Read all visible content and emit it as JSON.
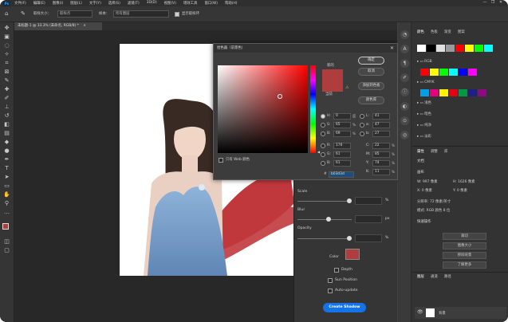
{
  "menubar": {
    "items": [
      "文件(F)",
      "编辑(E)",
      "图像(I)",
      "图层(L)",
      "文字(Y)",
      "选择(S)",
      "滤镜(T)",
      "3D(D)",
      "视图(V)",
      "增效工具",
      "窗口(W)",
      "帮助(H)"
    ],
    "minimize": "—",
    "restore": "❐",
    "close": "✕"
  },
  "optbar": {
    "sample_size_label": "取样大小：",
    "sample_size_value": "取样点",
    "sample_label": "样本：",
    "sample_value": "所有图层",
    "show_ring_label": "显示取样环"
  },
  "document": {
    "tab_title": "未标题-1 @ 33.3% (未命名, RGB/8) *",
    "tab_close": "×"
  },
  "picker": {
    "title": "拾色器（前景色）",
    "new_label": "新的",
    "current_label": "当前",
    "ok": "确定",
    "cancel": "取消",
    "add_swatch": "添加到色板",
    "color_libraries": "颜色库",
    "web_only": "只有 Web 颜色",
    "h_label": "H:",
    "h_value": "0",
    "h_unit": "度",
    "s_label": "S:",
    "s_value": "65",
    "s_unit": "%",
    "b_label": "B:",
    "b_value": "69",
    "b_unit": "%",
    "r_label": "R:",
    "r_value": "176",
    "g_label": "G:",
    "g_value": "61",
    "bl_label": "B:",
    "bl_value": "61",
    "l_label": "L:",
    "l_value": "41",
    "a_label": "a:",
    "a_value": "47",
    "lb_label": "b:",
    "lb_value": "27",
    "c_label": "C:",
    "c_value": "22",
    "c_unit": "%",
    "m_label": "M:",
    "m_value": "85",
    "m_unit": "%",
    "y_label": "Y:",
    "y_value": "74",
    "y_unit": "%",
    "k_label": "K:",
    "k_value": "11",
    "k_unit": "%",
    "hex_label": "#",
    "hex_value": "b03d3d",
    "new_color": "#b03d3d",
    "current_color": "#b03d3d"
  },
  "plugin": {
    "scale_label": "Scale",
    "scale_unit": "%",
    "blur_label": "Blur",
    "blur_unit": "px",
    "opacity_label": "Opacity",
    "opacity_unit": "%",
    "color_label": "Color",
    "color": "#b03d3d",
    "depth_label": "Depth",
    "sun_label": "Sun Position",
    "auto_label": "Auto-update",
    "create_button": "Create Shadow"
  },
  "rpanel": {
    "tabs": [
      "颜色",
      "色板",
      "渐变",
      "图案"
    ],
    "swatch_colors": [
      "#ffffff",
      "#000000",
      "#e0e0e0",
      "#9a9a9a",
      "#ff0000",
      "#ffff00",
      "#00ff00",
      "#00ffff",
      "#0000ff",
      "#ff00ff"
    ],
    "rgb_folder": "RGB",
    "rgb_colors": [
      "#ff0000",
      "#ffff00",
      "#00ff00",
      "#00ffff",
      "#0000ff",
      "#ff00ff"
    ],
    "cmyk_folder": "CMYK",
    "cmyk_colors": [
      "#00a0e9",
      "#e4007f",
      "#fff100",
      "#e60012",
      "#009944",
      "#1d2088",
      "#920783"
    ],
    "folders": [
      "浅色",
      "暗色",
      "纯净",
      "淡彩"
    ],
    "props_tabs": [
      "属性",
      "调整",
      "库"
    ],
    "doc_title": "文档",
    "canvas_label": "画布",
    "w_label": "W:",
    "w_value": "997 像素",
    "h_label": "H:",
    "h_value": "1626 像素",
    "x_label": "X:",
    "x_value": "0 像素",
    "y_label": "Y:",
    "y_value": "0 像素",
    "res_label": "分辨率:",
    "res_value": "72 像素/英寸",
    "mode_label": "模式:",
    "mode_value": "RGB 颜色",
    "depth_label": "8 位",
    "guides_label": "参考线",
    "quick_actions": "快速操作",
    "btn_trim": "裁切",
    "btn_rotate": "图像大小",
    "btn_clip": "移除背景",
    "btn_learn": "了解更多",
    "layers_tabs": [
      "图层",
      "通道",
      "路径"
    ],
    "layer_name": "背景"
  },
  "toolbar": {
    "tools": [
      "move-tool",
      "artboard-tool",
      "lasso-tool",
      "select-tool",
      "crop-tool",
      "frame-tool",
      "eyedropper-tool",
      "healing-tool",
      "brush-tool",
      "stamp-tool",
      "history-tool",
      "eraser-tool",
      "gradient-tool",
      "blur-tool",
      "dodge-tool",
      "pen-tool",
      "type-tool",
      "path-select-tool",
      "shape-tool",
      "hand-tool",
      "zoom-tool",
      "more-tool"
    ]
  }
}
